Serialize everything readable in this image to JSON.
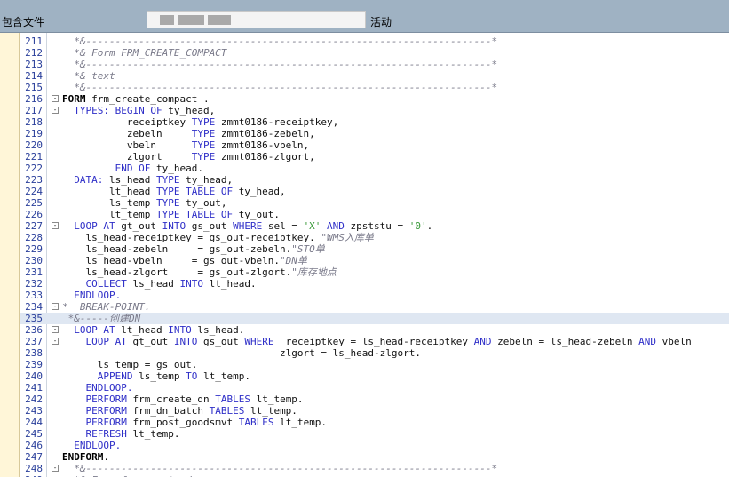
{
  "toolbar": {
    "include_label": "包含文件",
    "status_label": "活动",
    "colors": {
      "bar": "#9fb2c3",
      "keyword": "#2f2fc8",
      "comment": "#7a7a8a",
      "string": "#3a9a3a",
      "line_number": "#2a3f9b"
    }
  },
  "editor": {
    "lines": [
      {
        "n": "211",
        "fold": "",
        "hl": false,
        "parts": [
          [
            "cm",
            "  *&---------------------------------------------------------------------*"
          ]
        ]
      },
      {
        "n": "212",
        "fold": "",
        "hl": false,
        "parts": [
          [
            "cm",
            "  *& Form FRM_CREATE_COMPACT"
          ]
        ]
      },
      {
        "n": "213",
        "fold": "",
        "hl": false,
        "parts": [
          [
            "cm",
            "  *&---------------------------------------------------------------------*"
          ]
        ]
      },
      {
        "n": "214",
        "fold": "",
        "hl": false,
        "parts": [
          [
            "cm",
            "  *& text"
          ]
        ]
      },
      {
        "n": "215",
        "fold": "",
        "hl": false,
        "parts": [
          [
            "cm",
            "  *&---------------------------------------------------------------------*"
          ]
        ]
      },
      {
        "n": "216",
        "fold": "-",
        "hl": false,
        "parts": [
          [
            "kwb",
            "FORM"
          ],
          [
            "",
            " frm_create_compact ."
          ]
        ]
      },
      {
        "n": "217",
        "fold": "-",
        "hl": false,
        "parts": [
          [
            "kw",
            "  TYPES: BEGIN OF"
          ],
          [
            "",
            " ty_head,"
          ]
        ]
      },
      {
        "n": "218",
        "fold": "",
        "hl": false,
        "parts": [
          [
            "",
            "           receiptkey "
          ],
          [
            "kw",
            "TYPE"
          ],
          [
            "",
            " zmmt0186-receiptkey,"
          ]
        ]
      },
      {
        "n": "219",
        "fold": "",
        "hl": false,
        "parts": [
          [
            "",
            "           zebeln     "
          ],
          [
            "kw",
            "TYPE"
          ],
          [
            "",
            " zmmt0186-zebeln,"
          ]
        ]
      },
      {
        "n": "220",
        "fold": "",
        "hl": false,
        "parts": [
          [
            "",
            "           vbeln      "
          ],
          [
            "kw",
            "TYPE"
          ],
          [
            "",
            " zmmt0186-vbeln,"
          ]
        ]
      },
      {
        "n": "221",
        "fold": "",
        "hl": false,
        "parts": [
          [
            "",
            "           zlgort     "
          ],
          [
            "kw",
            "TYPE"
          ],
          [
            "",
            " zmmt0186-zlgort,"
          ]
        ]
      },
      {
        "n": "222",
        "fold": "",
        "hl": false,
        "parts": [
          [
            "kw",
            "         END OF"
          ],
          [
            "",
            " ty_head."
          ]
        ]
      },
      {
        "n": "223",
        "fold": "",
        "hl": false,
        "parts": [
          [
            "kw",
            "  DATA:"
          ],
          [
            "",
            " ls_head "
          ],
          [
            "kw",
            "TYPE"
          ],
          [
            "",
            " ty_head,"
          ]
        ]
      },
      {
        "n": "224",
        "fold": "",
        "hl": false,
        "parts": [
          [
            "",
            "        lt_head "
          ],
          [
            "kw",
            "TYPE TABLE OF"
          ],
          [
            "",
            " ty_head,"
          ]
        ]
      },
      {
        "n": "225",
        "fold": "",
        "hl": false,
        "parts": [
          [
            "",
            "        ls_temp "
          ],
          [
            "kw",
            "TYPE"
          ],
          [
            "",
            " ty_out,"
          ]
        ]
      },
      {
        "n": "226",
        "fold": "",
        "hl": false,
        "parts": [
          [
            "",
            "        lt_temp "
          ],
          [
            "kw",
            "TYPE TABLE OF"
          ],
          [
            "",
            " ty_out."
          ]
        ]
      },
      {
        "n": "227",
        "fold": "-",
        "hl": false,
        "parts": [
          [
            "kw",
            "  LOOP AT"
          ],
          [
            "",
            " gt_out "
          ],
          [
            "kw",
            "INTO"
          ],
          [
            "",
            " gs_out "
          ],
          [
            "kw",
            "WHERE"
          ],
          [
            "",
            " sel = "
          ],
          [
            "str",
            "'X'"
          ],
          [
            "kw",
            " AND"
          ],
          [
            "",
            " zpststu = "
          ],
          [
            "str",
            "'0'"
          ],
          [
            "",
            "."
          ]
        ]
      },
      {
        "n": "228",
        "fold": "",
        "hl": false,
        "parts": [
          [
            "",
            "    ls_head-receiptkey = gs_out-receiptkey. "
          ],
          [
            "cm",
            "\"WMS入库单"
          ]
        ]
      },
      {
        "n": "229",
        "fold": "",
        "hl": false,
        "parts": [
          [
            "",
            "    ls_head-zebeln     = gs_out-zebeln."
          ],
          [
            "cm",
            "\"STO单"
          ]
        ]
      },
      {
        "n": "230",
        "fold": "",
        "hl": false,
        "parts": [
          [
            "",
            "    ls_head-vbeln     = gs_out-vbeln."
          ],
          [
            "cm",
            "\"DN单"
          ]
        ]
      },
      {
        "n": "231",
        "fold": "",
        "hl": false,
        "parts": [
          [
            "",
            "    ls_head-zlgort     = gs_out-zlgort."
          ],
          [
            "cm",
            "\"库存地点"
          ]
        ]
      },
      {
        "n": "232",
        "fold": "",
        "hl": false,
        "parts": [
          [
            "kw",
            "    COLLECT"
          ],
          [
            "",
            " ls_head "
          ],
          [
            "kw",
            "INTO"
          ],
          [
            "",
            " lt_head."
          ]
        ]
      },
      {
        "n": "233",
        "fold": "",
        "hl": false,
        "parts": [
          [
            "kw",
            "  ENDLOOP."
          ]
        ]
      },
      {
        "n": "234",
        "fold": "-",
        "hl": false,
        "parts": [
          [
            "cm",
            "*  BREAK-POINT."
          ]
        ]
      },
      {
        "n": "235",
        "fold": "",
        "hl": true,
        "parts": [
          [
            "cm",
            " *&-----创建DN"
          ]
        ]
      },
      {
        "n": "236",
        "fold": "-",
        "hl": false,
        "parts": [
          [
            "kw",
            "  LOOP AT"
          ],
          [
            "",
            " lt_head "
          ],
          [
            "kw",
            "INTO"
          ],
          [
            "",
            " ls_head."
          ]
        ]
      },
      {
        "n": "237",
        "fold": "-",
        "hl": false,
        "parts": [
          [
            "kw",
            "    LOOP AT"
          ],
          [
            "",
            " gt_out "
          ],
          [
            "kw",
            "INTO"
          ],
          [
            "",
            " gs_out "
          ],
          [
            "kw",
            "WHERE"
          ],
          [
            "",
            "  receiptkey = ls_head-receiptkey "
          ],
          [
            "kw",
            "AND"
          ],
          [
            "",
            " zebeln = ls_head-zebeln "
          ],
          [
            "kw",
            "AND"
          ],
          [
            "",
            " vbeln"
          ]
        ]
      },
      {
        "n": "238",
        "fold": "",
        "hl": false,
        "parts": [
          [
            "",
            "                                     zlgort = ls_head-zlgort."
          ]
        ]
      },
      {
        "n": "239",
        "fold": "",
        "hl": false,
        "parts": [
          [
            "",
            "      ls_temp = gs_out."
          ]
        ]
      },
      {
        "n": "240",
        "fold": "",
        "hl": false,
        "parts": [
          [
            "kw",
            "      APPEND"
          ],
          [
            "",
            " ls_temp "
          ],
          [
            "kw",
            "TO"
          ],
          [
            "",
            " lt_temp."
          ]
        ]
      },
      {
        "n": "241",
        "fold": "",
        "hl": false,
        "parts": [
          [
            "kw",
            "    ENDLOOP."
          ]
        ]
      },
      {
        "n": "242",
        "fold": "",
        "hl": false,
        "parts": [
          [
            "kw",
            "    PERFORM"
          ],
          [
            "",
            " frm_create_dn "
          ],
          [
            "kw",
            "TABLES"
          ],
          [
            "",
            " lt_temp."
          ]
        ]
      },
      {
        "n": "243",
        "fold": "",
        "hl": false,
        "parts": [
          [
            "kw",
            "    PERFORM"
          ],
          [
            "",
            " frm_dn_batch "
          ],
          [
            "kw",
            "TABLES"
          ],
          [
            "",
            " lt_temp."
          ]
        ]
      },
      {
        "n": "244",
        "fold": "",
        "hl": false,
        "parts": [
          [
            "kw",
            "    PERFORM"
          ],
          [
            "",
            " frm_post_goodsmvt "
          ],
          [
            "kw",
            "TABLES"
          ],
          [
            "",
            " lt_temp."
          ]
        ]
      },
      {
        "n": "245",
        "fold": "",
        "hl": false,
        "parts": [
          [
            "kw",
            "    REFRESH"
          ],
          [
            "",
            " lt_temp."
          ]
        ]
      },
      {
        "n": "246",
        "fold": "",
        "hl": false,
        "parts": [
          [
            "kw",
            "  ENDLOOP."
          ]
        ]
      },
      {
        "n": "247",
        "fold": "",
        "hl": false,
        "parts": [
          [
            "kwb",
            "ENDFORM"
          ],
          [
            "",
            "."
          ]
        ]
      },
      {
        "n": "248",
        "fold": "-",
        "hl": false,
        "parts": [
          [
            "cm",
            "  *&---------------------------------------------------------------------*"
          ]
        ]
      },
      {
        "n": "249",
        "fold": "",
        "hl": false,
        "parts": [
          [
            "cm",
            "  *& Form frm_create_dn"
          ]
        ]
      }
    ]
  }
}
